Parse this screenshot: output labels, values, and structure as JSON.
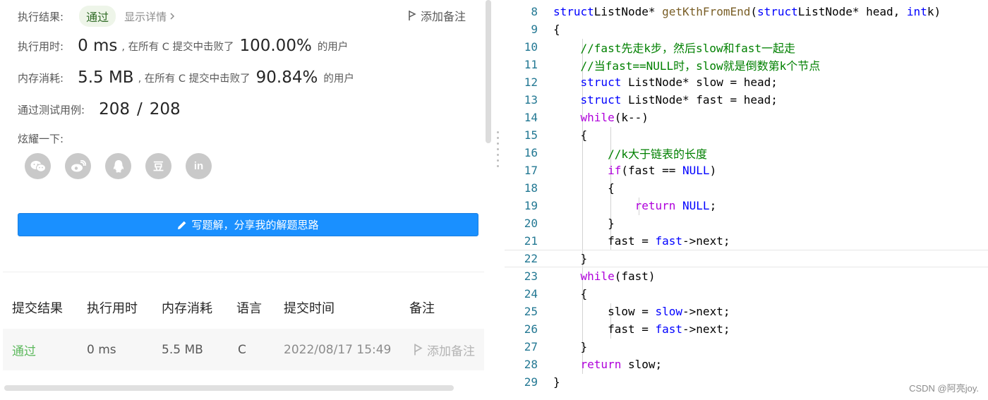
{
  "result": {
    "status_label": "执行结果:",
    "status_value": "通过",
    "detail_link": "显示详情",
    "add_note": "添加备注",
    "runtime_label": "执行用时:",
    "runtime_value": "0 ms",
    "runtime_mid": ", 在所有 C 提交中击败了",
    "runtime_pct": "100.00%",
    "runtime_suffix": "的用户",
    "memory_label": "内存消耗:",
    "memory_value": "5.5 MB",
    "memory_mid": ", 在所有 C 提交中击败了",
    "memory_pct": "90.84%",
    "memory_suffix": "的用户",
    "tests_label": "通过测试用例:",
    "tests_passed": "208",
    "tests_sep": "/",
    "tests_total": "208",
    "share_label": "炫耀一下:",
    "share_icons": [
      "wechat-icon",
      "weibo-icon",
      "qq-icon",
      "douban-icon",
      "linkedin-icon"
    ],
    "douban_glyph": "豆",
    "linkedin_glyph": "in",
    "write_button": "写题解，分享我的解题思路"
  },
  "submissions": {
    "headers": [
      "提交结果",
      "执行用时",
      "内存消耗",
      "语言",
      "提交时间",
      "备注"
    ],
    "row": {
      "status": "通过",
      "runtime": "0 ms",
      "memory": "5.5 MB",
      "language": "C",
      "time": "2022/08/17 15:49",
      "note": "添加备注"
    }
  },
  "colors": {
    "accent": "#1a90ff",
    "pass": "#5cb85c",
    "keyword": "#0000ff",
    "control": "#af00db",
    "comment": "#008000",
    "line_number": "#237893"
  },
  "code": {
    "lines": [
      {
        "n": "8",
        "tokens": [
          [
            "kw",
            "struct"
          ],
          [
            "",
            "ListNode* "
          ],
          [
            "fn",
            "getKthFromEnd"
          ],
          [
            "",
            "("
          ],
          [
            "kw",
            "struct"
          ],
          [
            "",
            "ListNode* head, "
          ],
          [
            "kw",
            "int"
          ],
          [
            "",
            "k)"
          ]
        ]
      },
      {
        "n": "9",
        "tokens": [
          [
            "",
            "{"
          ]
        ]
      },
      {
        "n": "10",
        "tokens": [
          [
            "cm",
            "    //fast先走k步，然后slow和fast一起走"
          ]
        ]
      },
      {
        "n": "11",
        "tokens": [
          [
            "cm",
            "    //当fast==NULL时，slow就是倒数第k个节点"
          ]
        ]
      },
      {
        "n": "12",
        "tokens": [
          [
            "",
            "    "
          ],
          [
            "kw",
            "struct"
          ],
          [
            "",
            ""
          ],
          [
            "",
            "ListNode* slow = head;"
          ]
        ]
      },
      {
        "n": "13",
        "tokens": [
          [
            "",
            "    "
          ],
          [
            "kw",
            "struct"
          ],
          [
            "",
            ""
          ],
          [
            "",
            "ListNode* fast = head;"
          ]
        ]
      },
      {
        "n": "14",
        "tokens": [
          [
            "",
            "    "
          ],
          [
            "ctl",
            "while"
          ],
          [
            "",
            "(k--)"
          ]
        ]
      },
      {
        "n": "15",
        "tokens": [
          [
            "",
            "    {"
          ]
        ]
      },
      {
        "n": "16",
        "tokens": [
          [
            "cm",
            "        //k大于链表的长度"
          ]
        ]
      },
      {
        "n": "17",
        "tokens": [
          [
            "",
            "        "
          ],
          [
            "ctl",
            "if"
          ],
          [
            "",
            "(fast == "
          ],
          [
            "kw",
            "NULL"
          ],
          [
            "",
            ")"
          ]
        ]
      },
      {
        "n": "18",
        "tokens": [
          [
            "",
            "        {"
          ]
        ]
      },
      {
        "n": "19",
        "tokens": [
          [
            "",
            "            "
          ],
          [
            "ctl",
            "return"
          ],
          [
            "",
            ""
          ],
          [
            "kw",
            "NULL"
          ],
          [
            "",
            ";"
          ]
        ]
      },
      {
        "n": "20",
        "tokens": [
          [
            "",
            "        }"
          ]
        ]
      },
      {
        "n": "21",
        "tokens": [
          [
            "",
            "        fast = "
          ],
          [
            "kw",
            "fast"
          ],
          [
            "",
            "->next;"
          ]
        ]
      },
      {
        "n": "22",
        "tokens": [
          [
            "",
            "    }"
          ]
        ]
      },
      {
        "n": "23",
        "tokens": [
          [
            "",
            "    "
          ],
          [
            "ctl",
            "while"
          ],
          [
            "",
            "(fast)"
          ]
        ]
      },
      {
        "n": "24",
        "tokens": [
          [
            "",
            "    {"
          ]
        ]
      },
      {
        "n": "25",
        "tokens": [
          [
            "",
            "        slow = "
          ],
          [
            "kw",
            "slow"
          ],
          [
            "",
            "->next;"
          ]
        ]
      },
      {
        "n": "26",
        "tokens": [
          [
            "",
            "        fast = "
          ],
          [
            "kw",
            "fast"
          ],
          [
            "",
            "->next;"
          ]
        ]
      },
      {
        "n": "27",
        "tokens": [
          [
            "",
            "    }"
          ]
        ]
      },
      {
        "n": "28",
        "tokens": [
          [
            "",
            "    "
          ],
          [
            "ctl",
            "return"
          ],
          [
            "",
            ""
          ],
          [
            "",
            "slow;"
          ]
        ]
      },
      {
        "n": "29",
        "tokens": [
          [
            "",
            "}"
          ]
        ]
      }
    ]
  },
  "watermark": "CSDN @阿亮joy."
}
